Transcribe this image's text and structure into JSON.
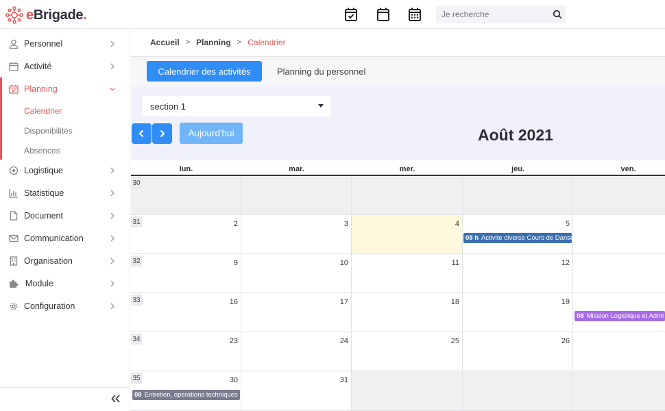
{
  "header": {
    "logo_text_e": "e",
    "logo_text_rest": "Brigade",
    "logo_dot": ".",
    "icons": [
      "calendar-check-icon",
      "calendar-icon",
      "calendar-grid-icon"
    ],
    "search_placeholder": "Je recherche"
  },
  "sidebar": {
    "items": [
      {
        "label": "Personnel",
        "icon": "user-icon"
      },
      {
        "label": "Activité",
        "icon": "calendar-icon"
      },
      {
        "label": "Planning",
        "icon": "calendar-check-icon"
      },
      {
        "label": "Logistique",
        "icon": "target-icon"
      },
      {
        "label": "Statistique",
        "icon": "bar-chart-icon"
      },
      {
        "label": "Document",
        "icon": "file-icon"
      },
      {
        "label": "Communication",
        "icon": "envelope-icon"
      },
      {
        "label": "Organisation",
        "icon": "building-icon"
      },
      {
        "label": "Module",
        "icon": "puzzle-icon"
      },
      {
        "label": "Configuration",
        "icon": "gear-icon"
      }
    ],
    "sub_items": [
      "Calendrier",
      "Disponibilités",
      "Absences"
    ]
  },
  "breadcrumb": {
    "home": "Accueil",
    "section": "Planning",
    "current": "Calendrier",
    "separator": ">"
  },
  "tabs": {
    "active": "Calendrier des activités",
    "other": "Planning du personnel"
  },
  "section_select": {
    "value": "section 1"
  },
  "today_button": "Aujourd'hui",
  "month_title": "Août 2021",
  "calendar": {
    "day_headers": [
      "lun.",
      "mar.",
      "mer.",
      "jeu.",
      "ven."
    ],
    "weeks": [
      {
        "week": "30",
        "days": [
          "",
          "",
          "",
          "",
          ""
        ]
      },
      {
        "week": "31",
        "days": [
          "2",
          "3",
          "4",
          "5",
          ""
        ]
      },
      {
        "week": "32",
        "days": [
          "9",
          "10",
          "11",
          "12",
          ""
        ]
      },
      {
        "week": "33",
        "days": [
          "16",
          "17",
          "18",
          "19",
          ""
        ]
      },
      {
        "week": "34",
        "days": [
          "23",
          "24",
          "25",
          "26",
          ""
        ]
      },
      {
        "week": "35",
        "days": [
          "30",
          "31",
          "",
          "",
          ""
        ]
      }
    ],
    "events": [
      {
        "time": "08 h",
        "title": "Activite diverse Cours de Danse",
        "color": "#3b6fb0"
      },
      {
        "time": "08",
        "title": "Mission Logistique et Admi",
        "color": "#a66be8"
      },
      {
        "time": "08",
        "title": "Entretien, operations techniques",
        "color": "#7b7b8f"
      }
    ],
    "today_color": "#fdf7dc"
  },
  "colors": {
    "accent": "#e05a5a",
    "primary": "#2f8df5",
    "today_button": "#6fb5f8"
  }
}
